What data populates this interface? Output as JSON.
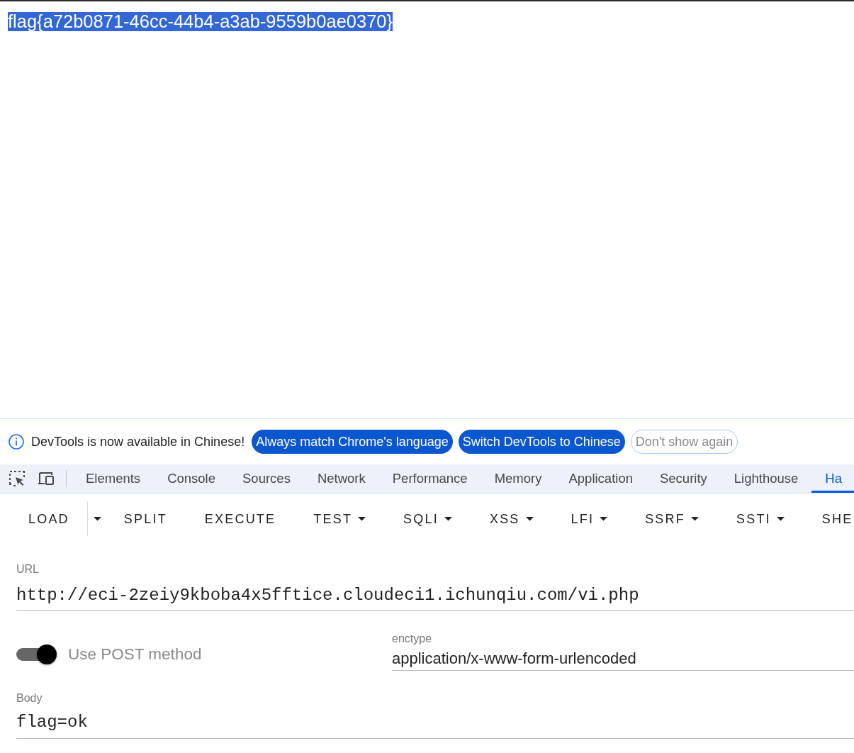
{
  "page": {
    "text": "flag{a72b0871-46cc-44b4-a3ab-9559b0ae0370}",
    "selected": true
  },
  "infobar": {
    "message": "DevTools is now available in Chinese!",
    "buttons": [
      {
        "label": "Always match Chrome's language",
        "kind": "primary"
      },
      {
        "label": "Switch DevTools to Chinese",
        "kind": "primary"
      },
      {
        "label": "Don't show again",
        "kind": "outline"
      }
    ]
  },
  "devtools_tabs": [
    {
      "label": "Elements",
      "selected": false
    },
    {
      "label": "Console",
      "selected": false
    },
    {
      "label": "Sources",
      "selected": false
    },
    {
      "label": "Network",
      "selected": false
    },
    {
      "label": "Performance",
      "selected": false
    },
    {
      "label": "Memory",
      "selected": false
    },
    {
      "label": "Application",
      "selected": false
    },
    {
      "label": "Security",
      "selected": false
    },
    {
      "label": "Lighthouse",
      "selected": false
    },
    {
      "label": "Ha",
      "selected": true
    }
  ],
  "hackbar": {
    "buttons": [
      {
        "label": "LOAD",
        "kind": "split"
      },
      {
        "label": "SPLIT",
        "kind": "plain"
      },
      {
        "label": "EXECUTE",
        "kind": "plain"
      },
      {
        "label": "TEST",
        "kind": "menu"
      },
      {
        "label": "SQLI",
        "kind": "menu"
      },
      {
        "label": "XSS",
        "kind": "menu"
      },
      {
        "label": "LFI",
        "kind": "menu"
      },
      {
        "label": "SSRF",
        "kind": "menu"
      },
      {
        "label": "SSTI",
        "kind": "menu"
      },
      {
        "label": "SHE",
        "kind": "plain"
      }
    ]
  },
  "url": {
    "label": "URL",
    "value": "http://eci-2zeiy9kboba4x5fftice.cloudeci1.ichunqiu.com/vi.php"
  },
  "post_method": {
    "label": "Use POST method",
    "on": true
  },
  "enctype": {
    "label": "enctype",
    "value": "application/x-www-form-urlencoded"
  },
  "body": {
    "label": "Body",
    "value": "flag=ok"
  }
}
